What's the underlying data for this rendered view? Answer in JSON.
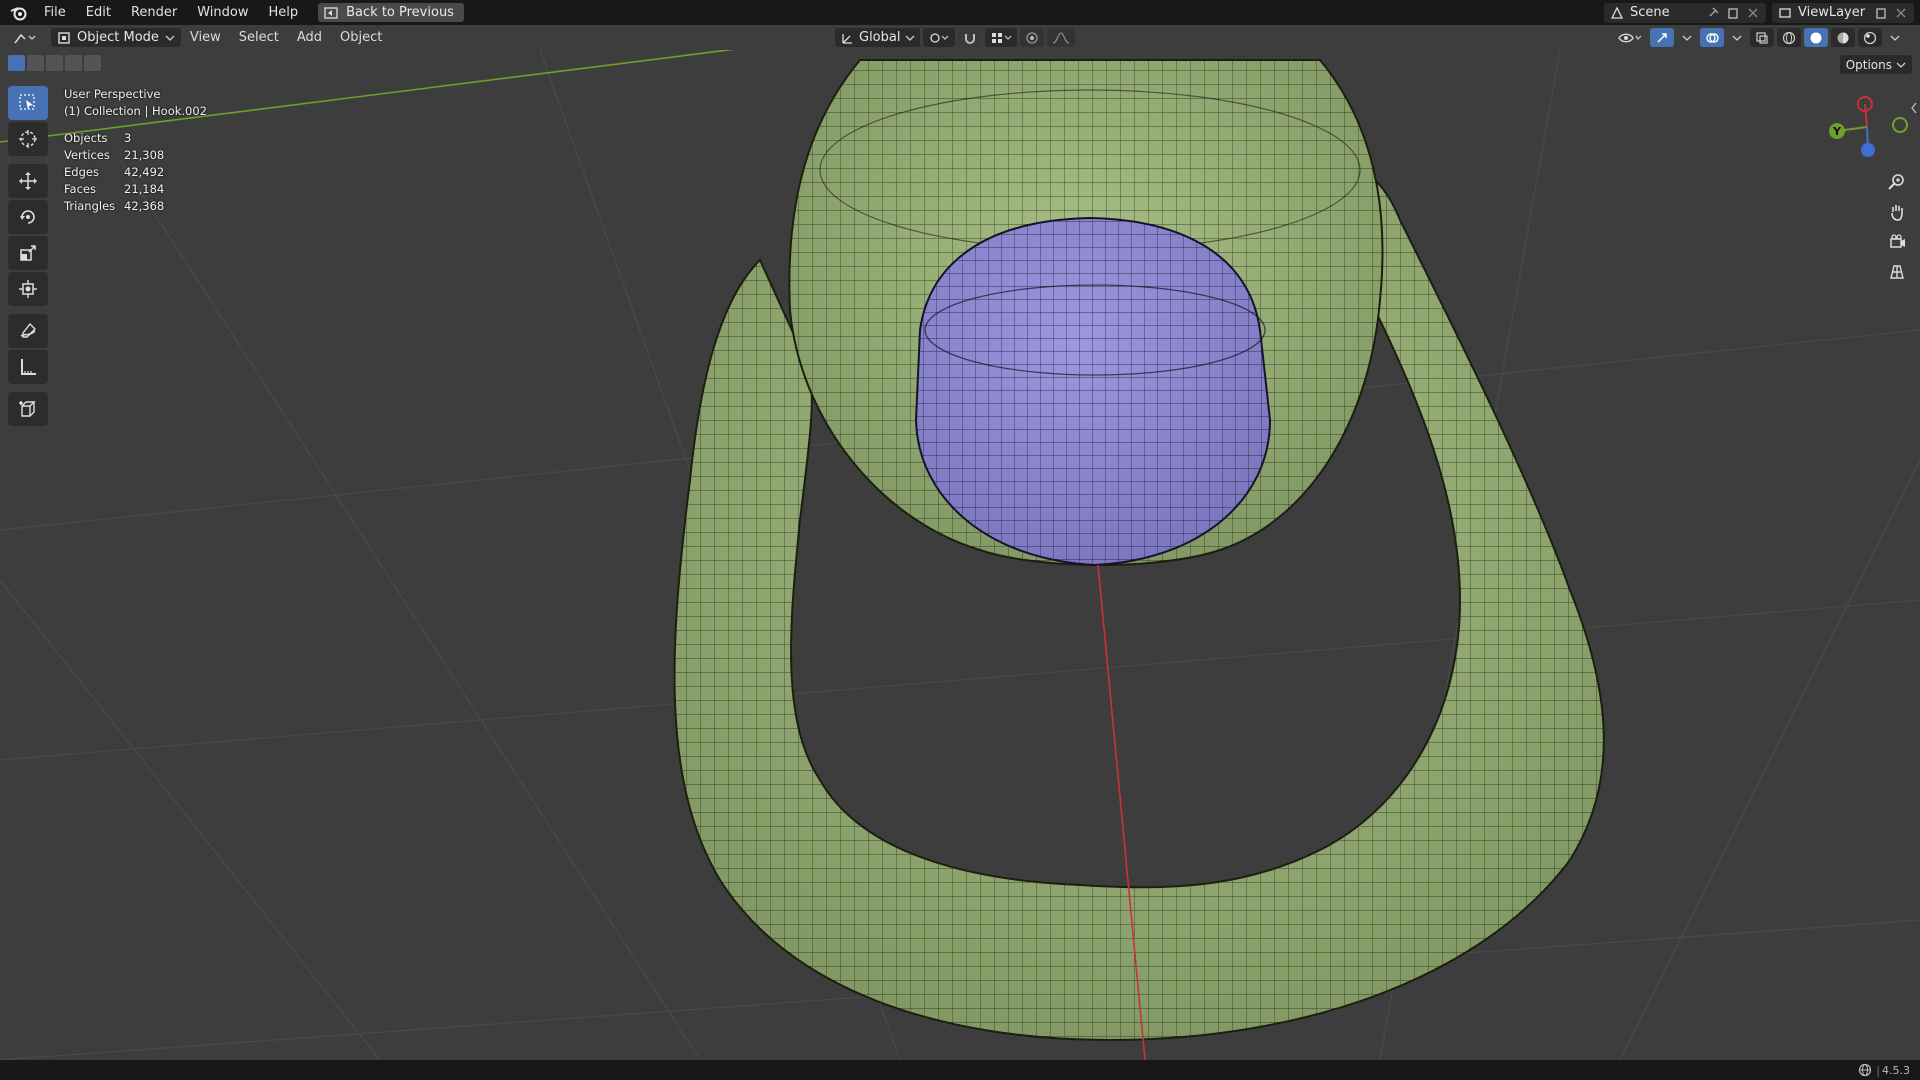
{
  "topbar": {
    "menus": [
      "File",
      "Edit",
      "Render",
      "Window",
      "Help"
    ],
    "back_label": "Back to Previous",
    "scene_label": "Scene",
    "viewlayer_label": "ViewLayer"
  },
  "viewport_header": {
    "mode": "Object Mode",
    "menus": [
      "View",
      "Select",
      "Add",
      "Object"
    ],
    "transform_orientation": "Global",
    "options_label": "Options"
  },
  "overlay": {
    "view_name": "User Perspective",
    "collection": "(1) Collection | Hook.002",
    "stats": [
      {
        "label": "Objects",
        "value": "3"
      },
      {
        "label": "Vertices",
        "value": "21,308"
      },
      {
        "label": "Edges",
        "value": "42,492"
      },
      {
        "label": "Faces",
        "value": "21,184"
      },
      {
        "label": "Triangles",
        "value": "42,368"
      }
    ]
  },
  "gizmo": {
    "axis_y": "Y"
  },
  "statusbar": {
    "version": "4.5.3"
  },
  "colors": {
    "mesh_green": "#9bb37a",
    "mesh_purple": "#8f8ad2",
    "active_blue": "#4772b3",
    "axis_red": "#c8323a",
    "axis_green": "#6ea12b"
  },
  "tools": [
    "select-box",
    "cursor",
    "move",
    "rotate",
    "scale",
    "transform",
    "annotate",
    "measure",
    "add-cube"
  ]
}
